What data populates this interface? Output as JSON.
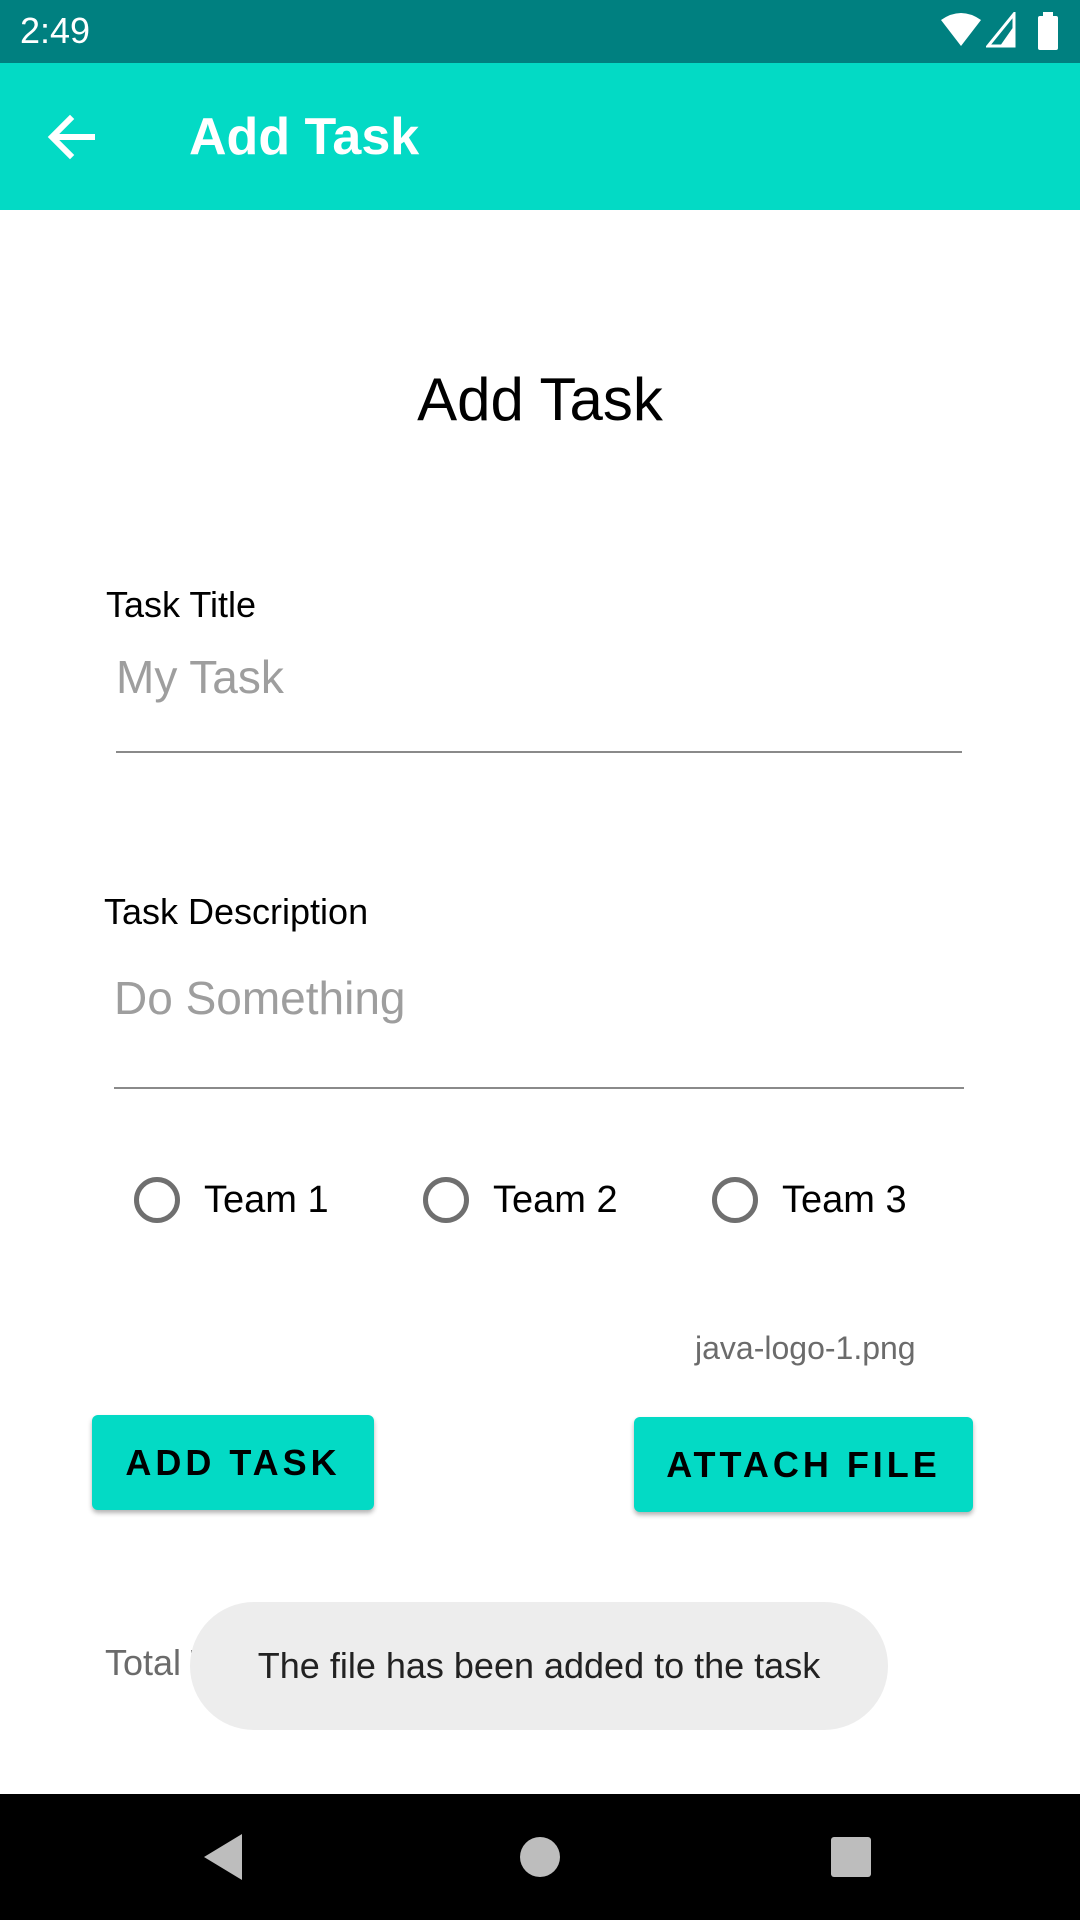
{
  "status_bar": {
    "time": "2:49",
    "icons": [
      "wifi-icon",
      "signal-icon",
      "battery-icon"
    ]
  },
  "app_bar": {
    "title": "Add Task",
    "back_icon": "arrow-left-icon"
  },
  "form": {
    "heading": "Add Task",
    "title_label": "Task Title",
    "title_placeholder": "My Task",
    "title_value": "",
    "description_label": "Task Description",
    "description_placeholder": "Do Something",
    "description_value": "",
    "teams": [
      {
        "label": "Team 1",
        "selected": false
      },
      {
        "label": "Team 2",
        "selected": false
      },
      {
        "label": "Team 3",
        "selected": false
      }
    ],
    "attached_file": "java-logo-1.png",
    "add_task_label": "ADD TASK",
    "attach_file_label": "ATTACH FILE",
    "total_label_visible": "Total Tas"
  },
  "toast": {
    "message": "The file has been added to the task"
  },
  "nav_bar": {
    "buttons": [
      "back-triangle-icon",
      "home-circle-icon",
      "recents-square-icon"
    ]
  },
  "colors": {
    "status_bar": "#008080",
    "app_bar": "#03dac5",
    "button": "#03dac5",
    "toast_bg": "#ededed"
  }
}
